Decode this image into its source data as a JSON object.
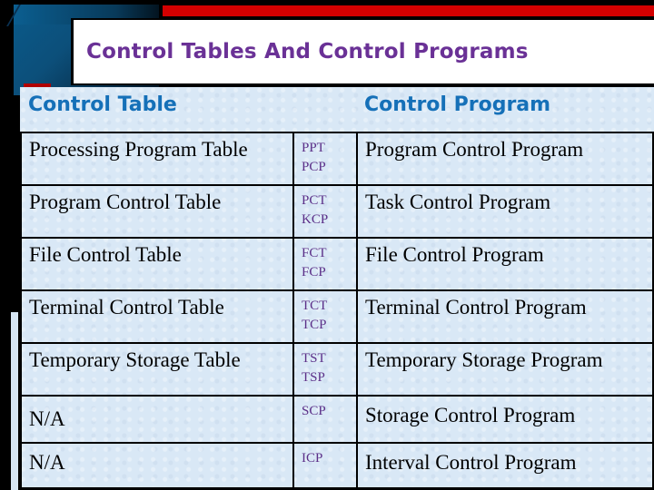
{
  "slide": {
    "title": "Control Tables And Control Programs",
    "colors": {
      "title": "#6a3196",
      "header": "#1570b8",
      "abbreviation": "#5b2f88",
      "accent_red": "#d30000",
      "accent_blue": "#0a5a8a",
      "table_background": "#d9e8f6"
    }
  },
  "table": {
    "headers": {
      "control_table": "Control Table",
      "abbreviations": "",
      "control_program": "Control Program"
    },
    "rows": [
      {
        "table": "Processing Program Table",
        "abbr_table": "PPT",
        "abbr_program": "PCP",
        "program": "Program Control Program"
      },
      {
        "table": "Program Control Table",
        "abbr_table": "PCT",
        "abbr_program": "KCP",
        "program": "Task Control Program"
      },
      {
        "table": "File Control Table",
        "abbr_table": "FCT",
        "abbr_program": "FCP",
        "program": "File Control Program"
      },
      {
        "table": "Terminal Control Table",
        "abbr_table": "TCT",
        "abbr_program": "TCP",
        "program": "Terminal Control Program"
      },
      {
        "table": "Temporary Storage Table",
        "abbr_table": "TST",
        "abbr_program": "TSP",
        "program": "Temporary Storage Program"
      },
      {
        "table": "N/A",
        "abbr_table": "SCP",
        "abbr_program": "",
        "program": "Storage Control Program"
      },
      {
        "table": "N/A",
        "abbr_table": "ICP",
        "abbr_program": "",
        "program": "Interval Control Program"
      }
    ]
  }
}
